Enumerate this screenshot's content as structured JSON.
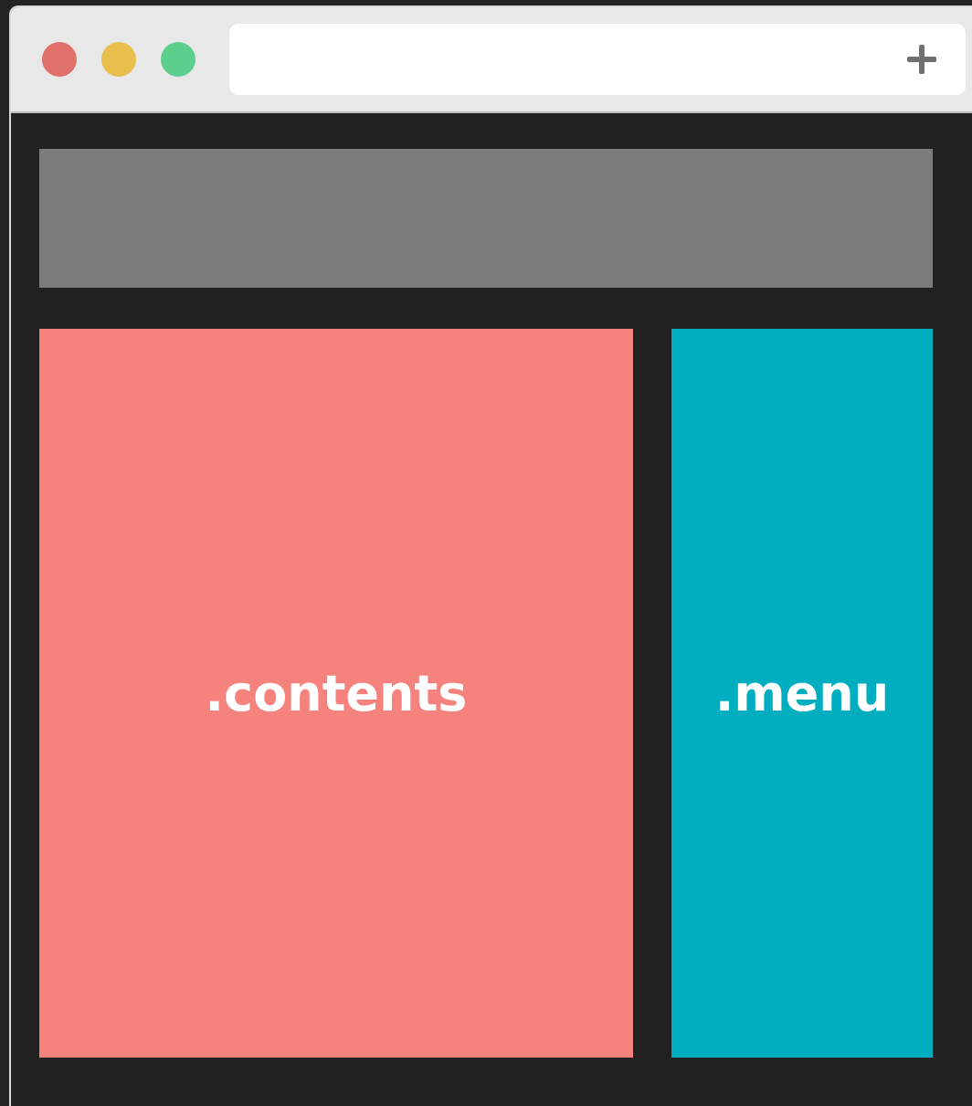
{
  "window": {
    "controls": [
      {
        "name": "close",
        "color": "#e0706a"
      },
      {
        "name": "minimize",
        "color": "#e8bf4c"
      },
      {
        "name": "maximize",
        "color": "#5ccf8c"
      }
    ],
    "new_tab_icon": "plus-icon"
  },
  "layout": {
    "header": {
      "label": "",
      "color": "#7b7b7b"
    },
    "contents": {
      "label": ".contents",
      "color": "#f6827e"
    },
    "menu": {
      "label": ".menu",
      "color": "#00aebf"
    },
    "background": "#212121"
  }
}
